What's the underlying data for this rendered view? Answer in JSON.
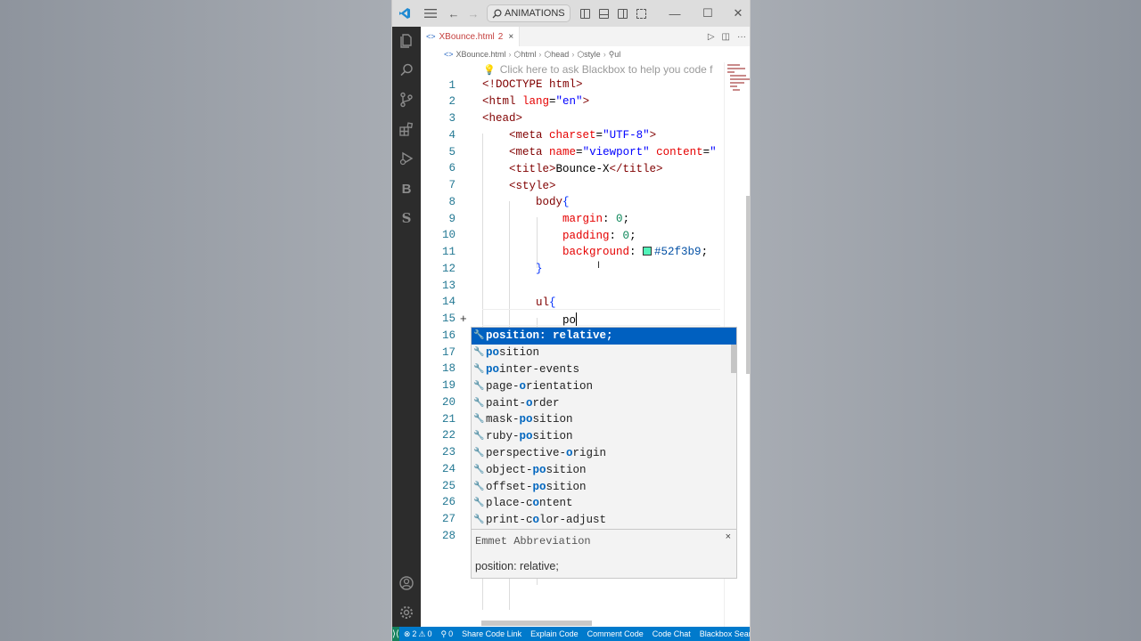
{
  "titlebar": {
    "search_text": "ANIMATIONS",
    "nav_back": "←",
    "nav_forward": "→",
    "minimize": "—",
    "maximize": "☐",
    "close": "✕"
  },
  "tab": {
    "filename": "XBounce.html",
    "problems": "2",
    "close": "×"
  },
  "breadcrumbs": [
    "XBounce.html",
    "html",
    "head",
    "style",
    "ul"
  ],
  "editor": {
    "hint": "Click here to ask Blackbox to help you code f",
    "line_numbers": [
      "1",
      "2",
      "3",
      "4",
      "5",
      "6",
      "7",
      "8",
      "9",
      "10",
      "11",
      "12",
      "13",
      "14",
      "15",
      "16",
      "17",
      "18",
      "19",
      "20",
      "21",
      "22",
      "23",
      "24",
      "25",
      "26",
      "27",
      "28"
    ],
    "code": {
      "l1": "<!DOCTYPE html>",
      "l2_tag": "<html",
      "l2_attr": " lang",
      "l2_eq": "=",
      "l2_val": "\"en\"",
      "l2_close": ">",
      "l3": "<head>",
      "l4_tag": "<meta",
      "l4_attr": " charset",
      "l4_val": "\"UTF-8\"",
      "l4_close": ">",
      "l5_tag": "<meta",
      "l5_attr1": " name",
      "l5_val1": "\"viewport\"",
      "l5_attr2": " content",
      "l5_val2": "\"",
      "l6_open": "<title>",
      "l6_text": "Bounce-X",
      "l6_close": "</title>",
      "l7": "<style>",
      "l8_sel": "body",
      "l8_brace": "{",
      "l9_prop": "margin",
      "l9_val": "0",
      "l10_prop": "padding",
      "l10_val": "0",
      "l11_prop": "background",
      "l11_val": "#52f3b9",
      "l12_brace": "}",
      "l14_sel": "ul",
      "l14_brace": "{",
      "l15_text": "po"
    }
  },
  "suggestions": [
    {
      "pre": "",
      "match": "po",
      "post": "sition: relative;"
    },
    {
      "pre": "",
      "match": "po",
      "post": "sition"
    },
    {
      "pre": "",
      "match": "po",
      "post": "inter-events"
    },
    {
      "pre": "p",
      "match": "",
      "post": "age-",
      "match2": "o",
      "post2": "rientation"
    },
    {
      "pre": "p",
      "match": "",
      "post": "aint-",
      "match2": "o",
      "post2": "rder"
    },
    {
      "pre": "mask-",
      "match": "po",
      "post": "sition"
    },
    {
      "pre": "ruby-",
      "match": "po",
      "post": "sition"
    },
    {
      "pre": "p",
      "match": "",
      "post": "erspective-",
      "match2": "o",
      "post2": "rigin"
    },
    {
      "pre": "object-",
      "match": "po",
      "post": "sition"
    },
    {
      "pre": "offset-",
      "match": "po",
      "post": "sition"
    },
    {
      "pre": "p",
      "match": "",
      "post": "lace-c",
      "match2": "o",
      "post2": "ntent"
    },
    {
      "pre": "p",
      "match": "",
      "post": "rint-c",
      "match2": "o",
      "post2": "lor-adjust"
    }
  ],
  "details": {
    "title": "Emmet Abbreviation",
    "body": "position: relative;",
    "close": "×"
  },
  "status": {
    "errors": "2",
    "warnings": "0",
    "ports": "0",
    "items": [
      "Share Code Link",
      "Explain Code",
      "Comment Code",
      "Code Chat",
      "Blackbox Searc"
    ]
  },
  "colors": {
    "accent": "#007acc",
    "selection": "#0060c0",
    "swatch": "#52f3b9"
  }
}
